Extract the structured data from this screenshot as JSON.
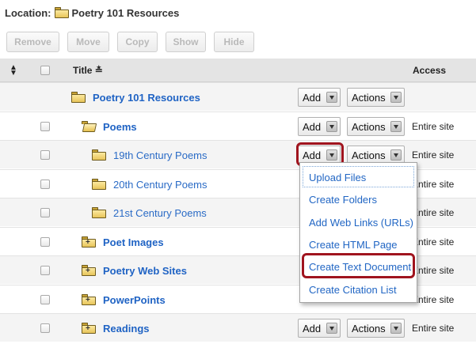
{
  "location": {
    "label": "Location:",
    "current": "Poetry 101 Resources"
  },
  "toolbar": {
    "buttons": [
      {
        "label": "Remove"
      },
      {
        "label": "Move"
      },
      {
        "label": "Copy"
      },
      {
        "label": "Show"
      },
      {
        "label": "Hide"
      }
    ]
  },
  "table": {
    "headers": {
      "title": "Title",
      "access": "Access"
    },
    "rows": [
      {
        "name": "Poetry 101 Resources",
        "access": "",
        "add": "Add",
        "actions": "Actions"
      },
      {
        "name": "Poems",
        "access": "Entire site",
        "add": "Add",
        "actions": "Actions"
      },
      {
        "name": "19th Century Poems",
        "access": "Entire site",
        "add": "Add",
        "actions": "Actions"
      },
      {
        "name": "20th Century Poems",
        "access": "Entire site"
      },
      {
        "name": "21st Century Poems",
        "access": "Entire site"
      },
      {
        "name": "Poet Images",
        "access": "Entire site"
      },
      {
        "name": "Poetry Web Sites",
        "access": "Entire site"
      },
      {
        "name": "PowerPoints",
        "access": "Entire site"
      },
      {
        "name": "Readings",
        "access": "Entire site",
        "add": "Add",
        "actions": "Actions"
      }
    ]
  },
  "add_menu": {
    "items": [
      {
        "label": "Upload Files"
      },
      {
        "label": "Create Folders"
      },
      {
        "label": "Add Web Links (URLs)"
      },
      {
        "label": "Create HTML Page"
      },
      {
        "label": "Create Text Document"
      },
      {
        "label": "Create Citation List"
      }
    ]
  },
  "colors": {
    "link": "#2a6bc6",
    "highlight": "#a0141e",
    "header_bg": "#e4e4e4",
    "folder": "#e8c55a"
  }
}
